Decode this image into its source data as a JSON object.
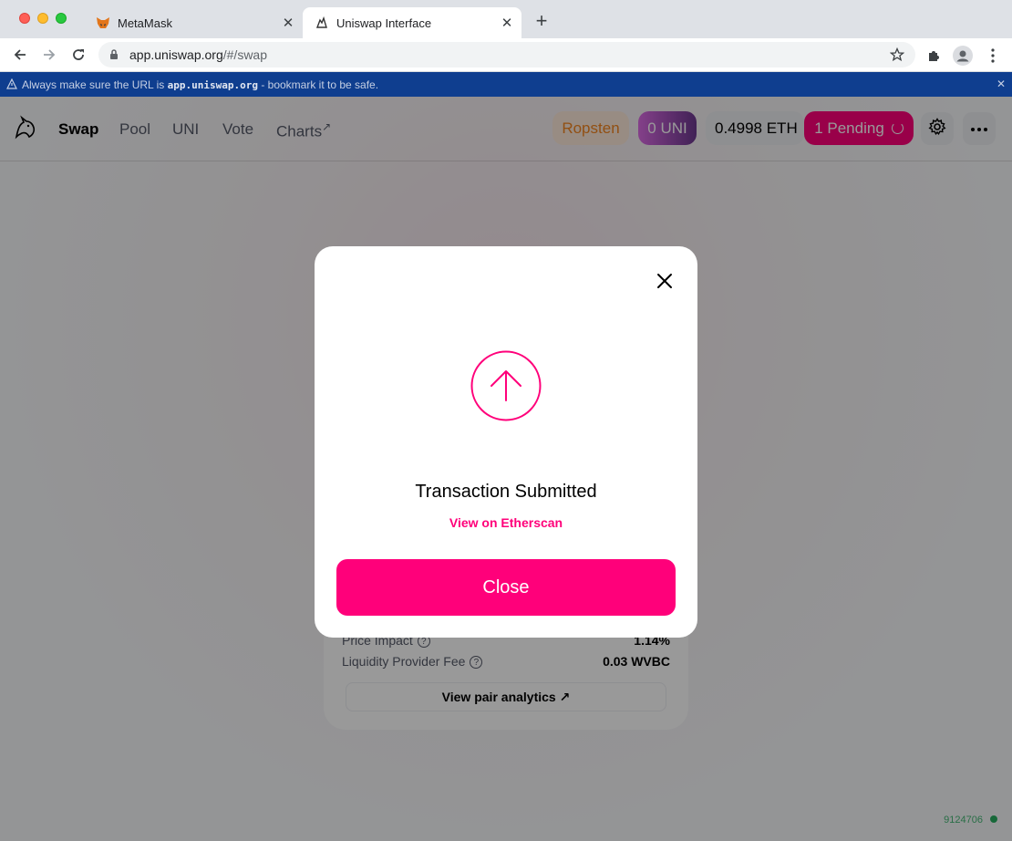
{
  "browser": {
    "tabs": [
      {
        "title": "MetaMask",
        "icon": "metamask-fox-icon"
      },
      {
        "title": "Uniswap Interface",
        "icon": "uniswap-unicorn-icon"
      }
    ],
    "address": {
      "host": "app.uniswap.org",
      "path": "/#/swap"
    }
  },
  "warning": {
    "prefix": "Always make sure the URL is",
    "domain": "app.uniswap.org",
    "suffix": "- bookmark it to be safe."
  },
  "header": {
    "nav": [
      "Swap",
      "Pool",
      "UNI",
      "Vote",
      "Charts"
    ],
    "charts_arrow": "↗",
    "network": "Ropsten",
    "uni_balance": "0 UNI",
    "eth_balance": "0.4998 ETH",
    "pending": "1 Pending"
  },
  "swap_details": {
    "price_impact_label": "Price Impact",
    "price_impact_value": "1.14%",
    "lp_fee_label": "Liquidity Provider Fee",
    "lp_fee_value": "0.03 WVBC",
    "analytics_label": "View pair analytics ↗"
  },
  "block_number": "9124706",
  "modal": {
    "title": "Transaction Submitted",
    "link": "View on Etherscan",
    "button": "Close"
  },
  "colors": {
    "brand_pink": "#ff007a",
    "warning_bar": "#0f3e8f",
    "network_orange": "#f3841e",
    "block_green": "#27ae60"
  }
}
